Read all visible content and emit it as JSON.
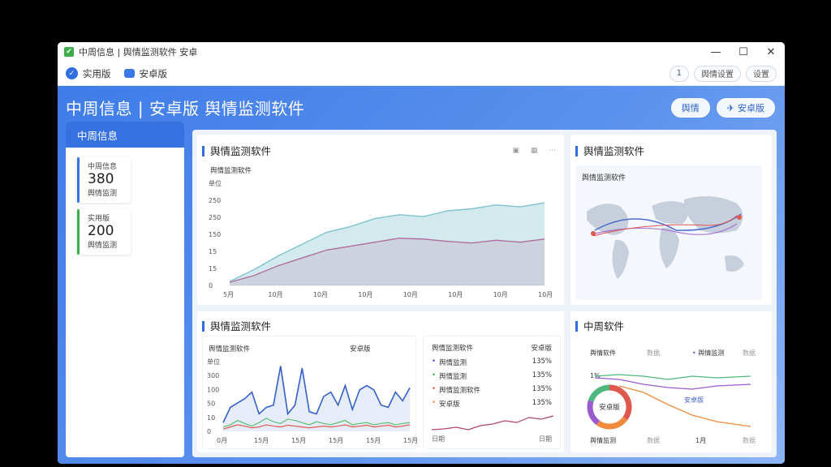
{
  "window": {
    "title": "中周信息 | 舆情监测软件 安卓",
    "controls": [
      "—",
      "☐",
      "✕"
    ]
  },
  "toolbar": {
    "item1_label": "实用版",
    "item2_label": "安卓版",
    "right_buttons": [
      "1",
      "舆情设置",
      "设置"
    ]
  },
  "banner": {
    "title": "中周信息 | 安卓版 舆情监测软件",
    "btn1_label": "舆情",
    "btn2_label": "安卓版"
  },
  "sidebar": {
    "header": "中周信息",
    "cards": [
      {
        "label": "中周信息",
        "value": "380",
        "sub": "舆情监测",
        "color": "#3572e0"
      },
      {
        "label": "实用版",
        "value": "200",
        "sub": "舆情监测",
        "color": "#3cae4a"
      }
    ]
  },
  "panel_main": {
    "title": "舆情监测软件",
    "subtitle": "舆情监测软件",
    "y_unit": "单位",
    "tools": [
      "▣",
      "▦",
      "···"
    ]
  },
  "panel_map": {
    "title": "舆情监测软件",
    "subtitle": "舆情监测软件"
  },
  "panel_line": {
    "title": "舆情监测软件",
    "legend1": "舆情监测软件",
    "legend2": "安卓版",
    "y_unit": "单位",
    "x_unit": "日期"
  },
  "panel_list": {
    "header_left": "舆情监测软件",
    "header_right": "安卓版",
    "rows": [
      {
        "label": "舆情监测",
        "value": "135%",
        "color": "#3a5bc7"
      },
      {
        "label": "舆情监测",
        "value": "135%",
        "color": "#3cae4a"
      },
      {
        "label": "舆情监测软件",
        "value": "135%",
        "color": "#e0574d"
      },
      {
        "label": "安卓版",
        "value": "135%",
        "color": "#f08a3c"
      }
    ],
    "footer_left": "日期",
    "footer_right": "日期"
  },
  "panel_donut": {
    "title": "中周软件",
    "legend_left": "舆情软件",
    "legend_mid": "数据",
    "legend_right": "舆情监测",
    "legend_right2": "数据",
    "center_label": "安卓版",
    "side_label": "安卓版",
    "start_label": "1%",
    "foot_left": "舆情监测",
    "foot_mid": "数据",
    "foot_mid2": "1月",
    "foot_right": "数据"
  },
  "chart_data": [
    {
      "type": "area",
      "title": "舆情监测软件",
      "y_ticks": [
        "单位",
        "250",
        "250",
        "150",
        "15",
        "15",
        "0"
      ],
      "categories": [
        "5月",
        "10月",
        "10月",
        "10月",
        "10月",
        "10月",
        "10月",
        "10月"
      ],
      "series": [
        {
          "name": "",
          "color": "#7fc4cf",
          "values": [
            10,
            40,
            75,
            105,
            135,
            150,
            170,
            180,
            175,
            190,
            195,
            205,
            200,
            210
          ]
        },
        {
          "name": "",
          "color": "#b06d9c",
          "values": [
            8,
            25,
            50,
            70,
            90,
            100,
            110,
            120,
            118,
            112,
            108,
            115,
            110,
            118
          ]
        }
      ],
      "ylim": [
        0,
        260
      ]
    },
    {
      "type": "line",
      "title": "舆情监测软件",
      "y_ticks": [
        "单位",
        "300",
        "100",
        "50",
        "10",
        "0"
      ],
      "categories": [
        "0月",
        "15月",
        "15月",
        "15月",
        "15月",
        "15月"
      ],
      "series": [
        {
          "name": "",
          "color": "#3560c8",
          "values": [
            20,
            55,
            65,
            75,
            90,
            40,
            55,
            60,
            150,
            40,
            60,
            145,
            45,
            40,
            80,
            90,
            60,
            105,
            50,
            95,
            105,
            95,
            60,
            55,
            90,
            70,
            100
          ]
        },
        {
          "name": "",
          "color": "#5cbf73",
          "values": [
            10,
            15,
            25,
            18,
            12,
            20,
            30,
            22,
            18,
            28,
            25,
            20,
            15,
            22,
            18,
            15,
            20,
            25,
            15,
            18,
            20,
            15,
            18,
            20,
            15,
            18,
            20
          ]
        },
        {
          "name": "",
          "color": "#e0574d",
          "values": [
            5,
            10,
            15,
            12,
            8,
            10,
            15,
            12,
            10,
            14,
            12,
            10,
            8,
            10,
            12,
            10,
            12,
            15,
            10,
            12,
            14,
            10,
            12,
            14,
            10,
            12,
            15
          ]
        }
      ],
      "ylim": [
        0,
        160
      ]
    },
    {
      "type": "pie",
      "title": "中周软件",
      "values": [
        35,
        25,
        20,
        20
      ],
      "colors": [
        "#e0574d",
        "#f08a3c",
        "#9a5bd0",
        "#4fb77d"
      ]
    }
  ],
  "colors": {
    "accent": "#2f6fe0",
    "banner": "#3f7ce8"
  }
}
